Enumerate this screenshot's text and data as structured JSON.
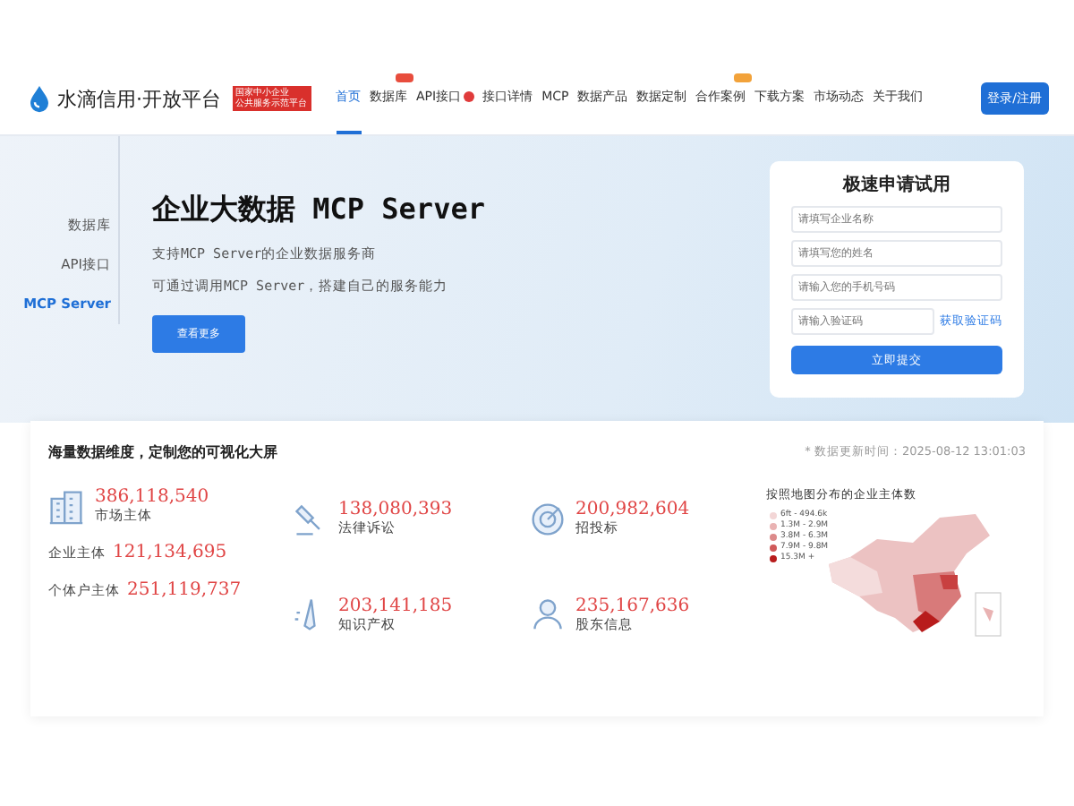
{
  "header": {
    "logo_text": "水滴信用·开放平台",
    "badge_lines": [
      "国家中小企业",
      "公共服务示范平台"
    ],
    "nav": [
      {
        "label": "首页",
        "selected": true,
        "kind": "plain"
      },
      {
        "label": "数据库",
        "selected": false,
        "kind": "hot"
      },
      {
        "label": "API接口",
        "selected": false,
        "kind": "dot"
      },
      {
        "label": "接口详情",
        "selected": false,
        "kind": "plain"
      },
      {
        "label": "MCP",
        "selected": false,
        "kind": "plain"
      },
      {
        "label": "数据产品",
        "selected": false,
        "kind": "plain"
      },
      {
        "label": "数据定制",
        "selected": false,
        "kind": "plain"
      },
      {
        "label": "合作案例",
        "selected": false,
        "kind": "new"
      },
      {
        "label": "下载方案",
        "selected": false,
        "kind": "plain"
      },
      {
        "label": "市场动态",
        "selected": false,
        "kind": "plain"
      },
      {
        "label": "关于我们",
        "selected": false,
        "kind": "plain"
      }
    ],
    "login_button": "登录/注册"
  },
  "hero": {
    "side_tabs": [
      {
        "label": "数据库",
        "selected": false
      },
      {
        "label": "API接口",
        "selected": false
      },
      {
        "label": "MCP Server",
        "selected": true
      }
    ],
    "title": "企业大数据 MCP Server",
    "lines": [
      "支持MCP Server的企业数据服务商",
      "可通过调用MCP Server，搭建自己的服务能力"
    ],
    "button": "查看更多"
  },
  "trial_form": {
    "title": "极速申请试用",
    "fields": [
      {
        "placeholder": "请填写企业名称"
      },
      {
        "placeholder": "请填写您的姓名"
      },
      {
        "placeholder": "请输入您的手机号码"
      },
      {
        "placeholder": "请输入验证码",
        "action": "获取验证码"
      }
    ],
    "submit": "立即提交"
  },
  "stats": {
    "title": "海量数据维度，定制您的可视化大屏",
    "updated": "* 数据更新时间：2025-08-12 13:01:03",
    "market": {
      "value": "386,118,540",
      "label": "市场主体",
      "rows": [
        {
          "label": "企业主体",
          "value": "121,134,695"
        },
        {
          "label": "个体户主体",
          "value": "251,119,737"
        }
      ]
    },
    "items": [
      {
        "kind": "law",
        "value": "138,080,393",
        "label": "法律诉讼"
      },
      {
        "kind": "target",
        "value": "200,982,604",
        "label": "招投标"
      },
      {
        "kind": "ip",
        "value": "203,141,185",
        "label": "知识产权"
      },
      {
        "kind": "person",
        "value": "235,167,636",
        "label": "股东信息"
      }
    ],
    "map": {
      "title": "按照地图分布的企业主体数",
      "legend": [
        {
          "label": "6ft - 494.6k",
          "color": "#f3d6d6"
        },
        {
          "label": "1.3M - 2.9M",
          "color": "#e9b3b3"
        },
        {
          "label": "3.8M - 6.3M",
          "color": "#dc8a8a"
        },
        {
          "label": "7.9M - 9.8M",
          "color": "#d05a5a"
        },
        {
          "label": "15.3M +",
          "color": "#b81c1c"
        }
      ]
    }
  }
}
